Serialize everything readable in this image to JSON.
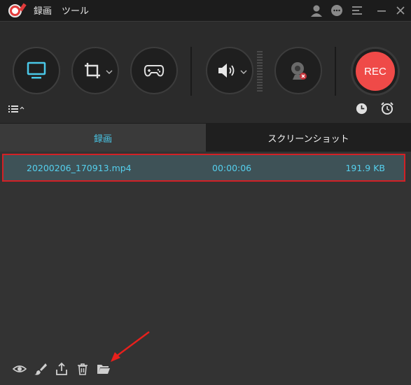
{
  "menu": {
    "record": "録画",
    "tools": "ツール"
  },
  "titlebar_icons": [
    "user-icon",
    "chat-icon",
    "menu-icon",
    "minimize-icon",
    "close-icon"
  ],
  "toolbar": {
    "rec_label": "REC",
    "buttons": [
      "monitor-icon",
      "crop-icon",
      "gamepad-icon",
      "speaker-icon",
      "webcam-icon"
    ]
  },
  "tabs": {
    "recording": "録画",
    "screenshot": "スクリーンショット"
  },
  "files": [
    {
      "name": "20200206_170913.mp4",
      "duration": "00:00:06",
      "size": "191.9 KB"
    }
  ],
  "colors": {
    "accent": "#4ac8e8",
    "rec": "#ef4a48",
    "highlight_border": "#d32025",
    "arrow": "#e8201c"
  },
  "bottom_icons": [
    "eye-icon",
    "brush-icon",
    "share-icon",
    "trash-icon",
    "folder-icon"
  ]
}
